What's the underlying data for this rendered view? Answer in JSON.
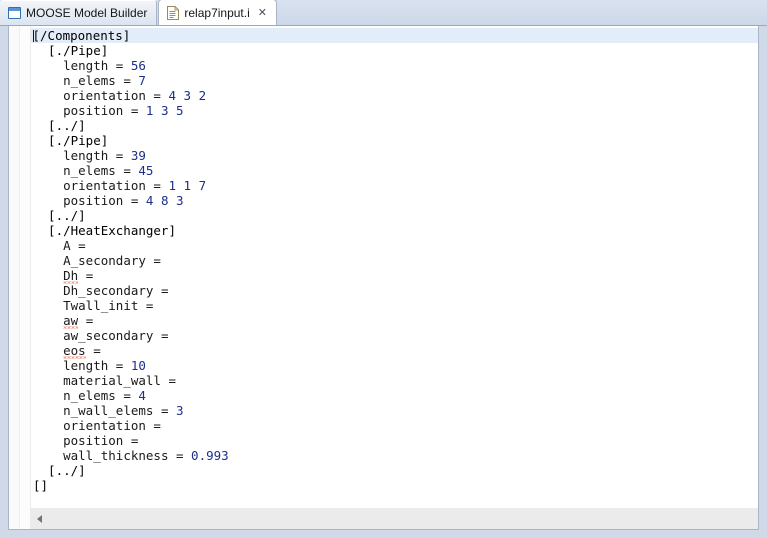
{
  "window": {
    "background_color": "#cfd9e8"
  },
  "tabs": [
    {
      "label": "MOOSE Model Builder",
      "icon": "window-icon",
      "active": false,
      "closable": false
    },
    {
      "label": "relap7input.i",
      "icon": "document-icon",
      "active": true,
      "closable": true,
      "close_glyph": "✕"
    }
  ],
  "editor": {
    "colors": {
      "section": "#000000",
      "key": "#1a1a1a",
      "value": "#1c2f8c",
      "current_line_highlight": "#e3ecf9",
      "spellcheck_underline": "#d94b2b",
      "background": "#ffffff"
    },
    "current_line_index": 0,
    "lines": [
      {
        "indent": 0,
        "type": "section",
        "text": "[/Components]",
        "current": true,
        "caret": true
      },
      {
        "indent": 1,
        "type": "section",
        "text": "[./Pipe]"
      },
      {
        "indent": 2,
        "type": "pair",
        "key": "length",
        "value": "56"
      },
      {
        "indent": 2,
        "type": "pair",
        "key": "n_elems",
        "value": "7"
      },
      {
        "indent": 2,
        "type": "pair",
        "key": "orientation",
        "value": "4 3 2"
      },
      {
        "indent": 2,
        "type": "pair",
        "key": "position",
        "value": "1 3 5"
      },
      {
        "indent": 1,
        "type": "section",
        "text": "[../]"
      },
      {
        "indent": 1,
        "type": "section",
        "text": "[./Pipe]"
      },
      {
        "indent": 2,
        "type": "pair",
        "key": "length",
        "value": "39"
      },
      {
        "indent": 2,
        "type": "pair",
        "key": "n_elems",
        "value": "45"
      },
      {
        "indent": 2,
        "type": "pair",
        "key": "orientation",
        "value": "1 1 7"
      },
      {
        "indent": 2,
        "type": "pair",
        "key": "position",
        "value": "4 8 3"
      },
      {
        "indent": 1,
        "type": "section",
        "text": "[../]"
      },
      {
        "indent": 1,
        "type": "section",
        "text": "[./HeatExchanger]"
      },
      {
        "indent": 2,
        "type": "pair",
        "key": "A",
        "value": ""
      },
      {
        "indent": 2,
        "type": "pair",
        "key": "A_secondary",
        "value": ""
      },
      {
        "indent": 2,
        "type": "pair",
        "key": "Dh",
        "value": "",
        "misspelled": true
      },
      {
        "indent": 2,
        "type": "pair",
        "key": "Dh_secondary",
        "value": ""
      },
      {
        "indent": 2,
        "type": "pair",
        "key": "Twall_init",
        "value": ""
      },
      {
        "indent": 2,
        "type": "pair",
        "key": "aw",
        "value": "",
        "misspelled": true
      },
      {
        "indent": 2,
        "type": "pair",
        "key": "aw_secondary",
        "value": ""
      },
      {
        "indent": 2,
        "type": "pair",
        "key": "eos",
        "value": "",
        "misspelled": true
      },
      {
        "indent": 2,
        "type": "pair",
        "key": "length",
        "value": "10"
      },
      {
        "indent": 2,
        "type": "pair",
        "key": "material_wall",
        "value": ""
      },
      {
        "indent": 2,
        "type": "pair",
        "key": "n_elems",
        "value": "4"
      },
      {
        "indent": 2,
        "type": "pair",
        "key": "n_wall_elems",
        "value": "3"
      },
      {
        "indent": 2,
        "type": "pair",
        "key": "orientation",
        "value": ""
      },
      {
        "indent": 2,
        "type": "pair",
        "key": "position",
        "value": ""
      },
      {
        "indent": 2,
        "type": "pair",
        "key": "wall_thickness",
        "value": "0.993"
      },
      {
        "indent": 1,
        "type": "section",
        "text": "[../]"
      },
      {
        "indent": 0,
        "type": "section",
        "text": "[]"
      }
    ]
  },
  "scrollbar": {
    "orientation": "horizontal",
    "left_arrow_glyph": "◀"
  }
}
